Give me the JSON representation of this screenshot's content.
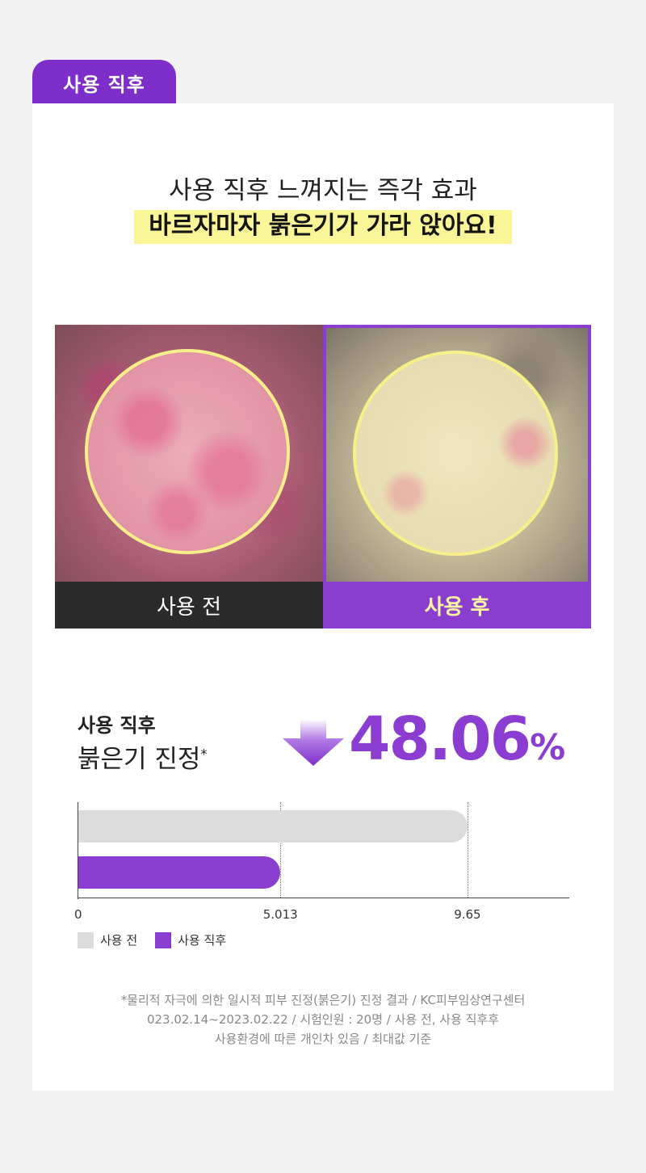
{
  "tab": {
    "label": "사용 직후"
  },
  "header": {
    "subtitle": "사용 직후 느껴지는 즉각 효과",
    "headline": "바르자마자 붉은기가 가라 앉아요!"
  },
  "photos": {
    "before_label": "사용 전",
    "after_label": "사용 후"
  },
  "metric": {
    "title": "사용 직후",
    "subtitle": "붉은기 진정",
    "asterisk": "*",
    "value": "48.06",
    "unit": "%"
  },
  "chart_data": {
    "type": "bar",
    "orientation": "horizontal",
    "categories": [
      "사용 전",
      "사용 직후"
    ],
    "values": [
      9.65,
      5.013
    ],
    "ticks": [
      "0",
      "5.013",
      "9.65"
    ],
    "xlim": [
      0,
      12.2
    ],
    "colors": [
      "#dcdcdc",
      "#8a3ed0"
    ],
    "legend": [
      "사용 전",
      "사용 직후"
    ]
  },
  "footnote": {
    "line1": "*물리적 자극에 의한 일시적 피부 진정(붉은기) 진정 결과 / KC피부임상연구센터",
    "line2": "023.02.14~2023.02.22 / 시험인원 : 20명 / 사용 전, 사용 직후후",
    "line3": "사용환경에 따른 개인차 있음 / 최대값 기준"
  },
  "colors": {
    "accent": "#8a3ed0",
    "highlight": "#fbf59a",
    "circle": "#f7ef8a"
  }
}
